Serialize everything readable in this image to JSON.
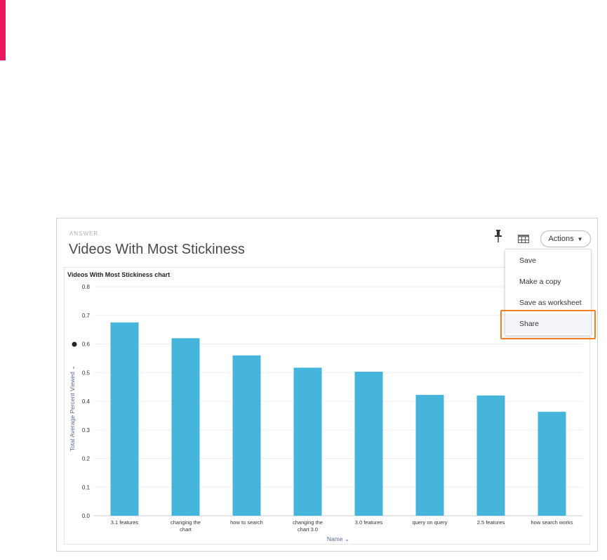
{
  "answer": {
    "label": "ANSWER",
    "title": "Videos With Most Stickiness"
  },
  "toolbar": {
    "pin_icon": "pin-icon",
    "table_icon": "table-view-icon",
    "actions_label": "Actions"
  },
  "actions_menu": {
    "items": [
      "Save",
      "Make a copy",
      "Save as worksheet",
      "Share"
    ],
    "highlighted": "Share"
  },
  "colors": {
    "bar": "#45b5dc",
    "accent": "#e8175d",
    "highlight": "#f57f20"
  },
  "chart_data": {
    "type": "bar",
    "title": "Videos With Most Stickiness chart",
    "xlabel": "Name",
    "ylabel": "Total Average Percent Viewed",
    "ylim": [
      0,
      0.8
    ],
    "yticks": [
      "0.0",
      "0.1",
      "0.2",
      "0.3",
      "0.4",
      "0.5",
      "0.6",
      "0.7",
      "0.8"
    ],
    "categories": [
      [
        "3.1 features"
      ],
      [
        "changing the",
        "chart"
      ],
      [
        "how to search"
      ],
      [
        "changing the",
        "chart 3.0"
      ],
      [
        "3.0 features"
      ],
      [
        "query on query"
      ],
      [
        "2.5 features"
      ],
      [
        "how search works"
      ]
    ],
    "values": [
      0.675,
      0.62,
      0.56,
      0.517,
      0.503,
      0.422,
      0.42,
      0.363
    ],
    "grid": true,
    "legend": "none"
  }
}
